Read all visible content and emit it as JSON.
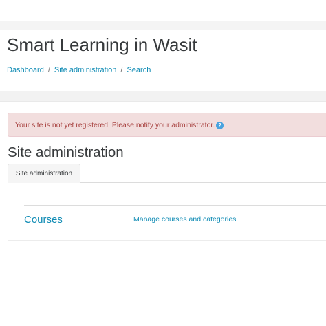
{
  "site": {
    "title": "Smart Learning in Wasit"
  },
  "breadcrumb": {
    "items": [
      "Dashboard",
      "Site administration",
      "Search"
    ],
    "separator": "/"
  },
  "alert": {
    "text": "Your site is not yet registered. Please notify your administrator.",
    "help_icon": "?"
  },
  "page": {
    "heading": "Site administration"
  },
  "tabs": [
    {
      "label": "Site administration",
      "active": true
    }
  ],
  "section": {
    "title": "Courses",
    "links": [
      "Manage courses and categories"
    ]
  },
  "colors": {
    "link": "#0f8bb4",
    "alert_bg": "#f2dede",
    "alert_text": "#a94442",
    "help_icon": "#4aa3df"
  }
}
